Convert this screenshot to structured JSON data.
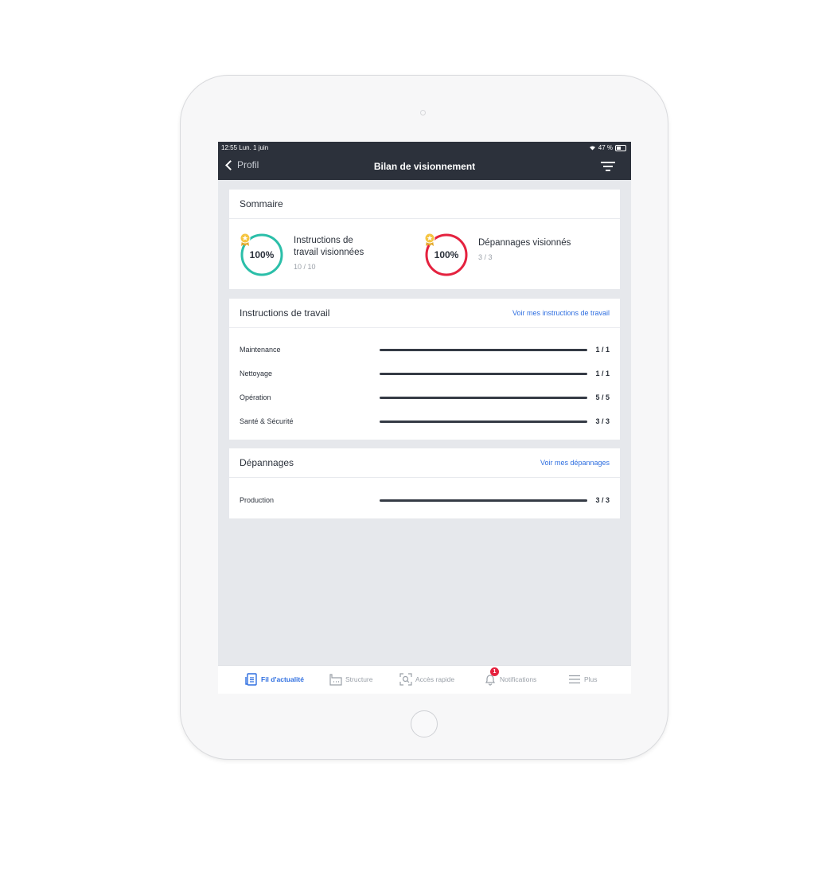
{
  "status_bar": {
    "time": "12:55  Lun. 1 juin",
    "battery": "47 %"
  },
  "nav": {
    "back_label": "Profil",
    "title": "Bilan de visionnement"
  },
  "summary": {
    "title": "Sommaire",
    "items": [
      {
        "percent_label": "100%",
        "label_line1": "Instructions de",
        "label_line2": "travail visionnées",
        "count": "10 / 10",
        "progress": 1.0,
        "color": "#2bbfa9"
      },
      {
        "percent_label": "100%",
        "label_line1": "Dépannages visionnés",
        "label_line2": "",
        "count": "3 / 3",
        "progress": 1.0,
        "color": "#e5223f"
      }
    ]
  },
  "instructions": {
    "title": "Instructions de travail",
    "link": "Voir mes instructions de travail",
    "rows": [
      {
        "label": "Maintenance",
        "count": "1 / 1",
        "progress": 1.0
      },
      {
        "label": "Nettoyage",
        "count": "1 / 1",
        "progress": 1.0
      },
      {
        "label": "Opération",
        "count": "5 / 5",
        "progress": 1.0
      },
      {
        "label": "Santé & Sécurité",
        "count": "3 / 3",
        "progress": 1.0
      }
    ]
  },
  "troubleshooting": {
    "title": "Dépannages",
    "link": "Voir mes dépannages",
    "rows": [
      {
        "label": "Production",
        "count": "3 / 3",
        "progress": 1.0
      }
    ]
  },
  "tabbar": {
    "items": [
      {
        "label": "Fil d'actualité",
        "icon": "news-feed-icon",
        "active": true
      },
      {
        "label": "Structure",
        "icon": "factory-icon",
        "active": false
      },
      {
        "label": "Accès rapide",
        "icon": "scan-icon",
        "active": false
      },
      {
        "label": "Notifications",
        "icon": "bell-icon",
        "active": false,
        "badge": "1"
      },
      {
        "label": "Plus",
        "icon": "menu-icon",
        "active": false
      }
    ]
  },
  "colors": {
    "accent": "#2f6fe0",
    "topbar": "#2c313b",
    "bar_fill": "#353b45",
    "badge": "#e5223f"
  }
}
